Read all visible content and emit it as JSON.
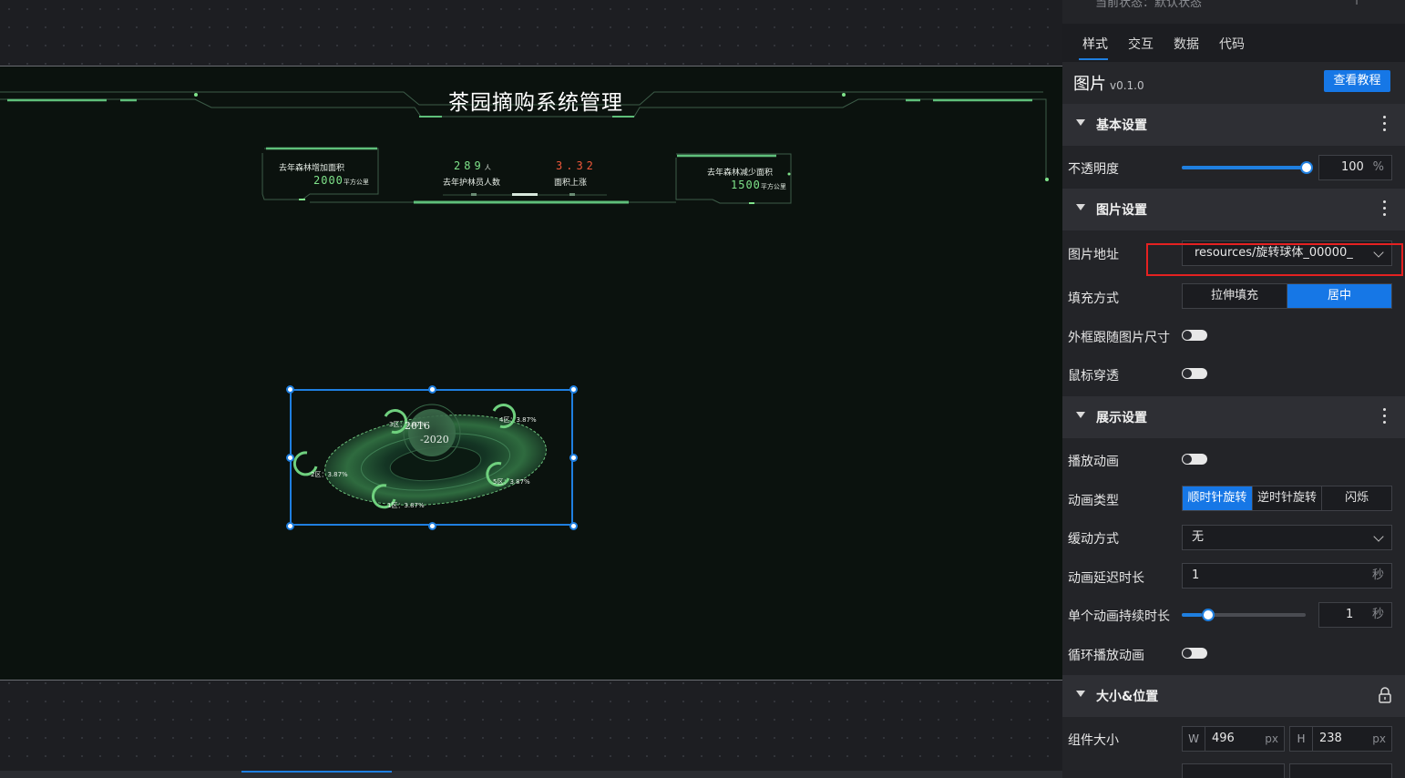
{
  "canvas": {
    "screen_title": "茶园摘购系统管理",
    "left_panel": {
      "label": "去年森林增加面积",
      "value": "2000",
      "unit": "平方公里"
    },
    "right_panel": {
      "label": "去年森林减少面积",
      "value": "1500",
      "unit": "平方公里"
    },
    "center_stat_1": {
      "value": "289",
      "unit": "人",
      "label": "去年护林员人数"
    },
    "center_stat_2": {
      "value": "3.32",
      "label": "面积上涨"
    },
    "orbit": {
      "center_years": [
        "2016",
        "-2020"
      ],
      "nodes": [
        "3区：3.87%",
        "4区：3.87%",
        "2区：3.87%",
        "5区：3.87%",
        "1区：3.87%"
      ]
    }
  },
  "panel": {
    "status_text": "当前状态：默认状态",
    "tabs": [
      "样式",
      "交互",
      "数据",
      "代码"
    ],
    "component_name": "图片",
    "component_version": "v0.1.0",
    "tutorial_button": "查看教程",
    "sections": {
      "basic": "基本设置",
      "image": "图片设置",
      "display": "展示设置",
      "size_position": "大小&位置"
    },
    "opacity": {
      "label": "不透明度",
      "value": "100",
      "unit": "%",
      "level": 1.0
    },
    "image_url": {
      "label": "图片地址",
      "value": "resources/旋转球体_00000_"
    },
    "fill_mode": {
      "label": "填充方式",
      "options": [
        "拉伸填充",
        "居中"
      ],
      "selected": "居中"
    },
    "follow_size": {
      "label": "外框跟随图片尺寸"
    },
    "mouse_through": {
      "label": "鼠标穿透"
    },
    "play_animation": {
      "label": "播放动画"
    },
    "animation_type": {
      "label": "动画类型",
      "options": [
        "顺时针旋转",
        "逆时针旋转",
        "闪烁"
      ],
      "selected": "顺时针旋转"
    },
    "easing": {
      "label": "缓动方式",
      "value": "无"
    },
    "delay": {
      "label": "动画延迟时长",
      "value": "1",
      "unit": "秒"
    },
    "duration": {
      "label": "单个动画持续时长",
      "value": "1",
      "unit": "秒",
      "level": 0.06
    },
    "loop": {
      "label": "循环播放动画"
    },
    "component_size": {
      "label": "组件大小",
      "w_prefix": "W",
      "w": "496",
      "h_prefix": "H",
      "h": "238",
      "unit": "px"
    }
  },
  "colors": {
    "accent": "#1677e6",
    "highlight": "#e52121",
    "neon_green": "#7fe38a"
  }
}
